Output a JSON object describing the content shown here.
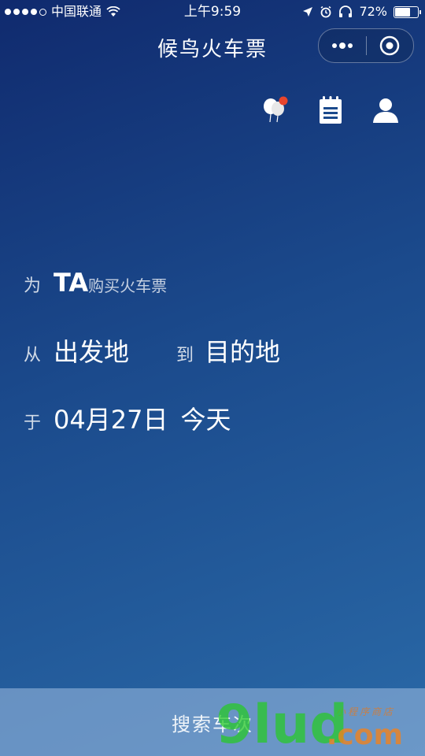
{
  "status_bar": {
    "carrier": "中国联通",
    "time": "上午9:59",
    "battery": "72%",
    "battery_level": 0.72
  },
  "nav": {
    "title": "候鸟火车票"
  },
  "toolbar": {
    "icons": [
      "balloons-icon",
      "notepad-icon",
      "user-icon"
    ]
  },
  "form": {
    "for_label": "为",
    "ta": "TA",
    "buy_text": "购买火车票",
    "from_label": "从",
    "from_placeholder": "出发地",
    "to_label": "到",
    "to_placeholder": "目的地",
    "date_label": "于",
    "date_value": "04月27日",
    "day_label": "今天"
  },
  "search_button": {
    "label": "搜索车次"
  },
  "watermark": {
    "brand": "9lud",
    "suffix": ".com",
    "tagline": "小程序商店"
  },
  "colors": {
    "bg_top": "#102a6e",
    "bg_bottom": "#2a6aa8",
    "badge_red": "#e8452c",
    "watermark_green": "#28c828",
    "watermark_orange": "#f0821e"
  }
}
